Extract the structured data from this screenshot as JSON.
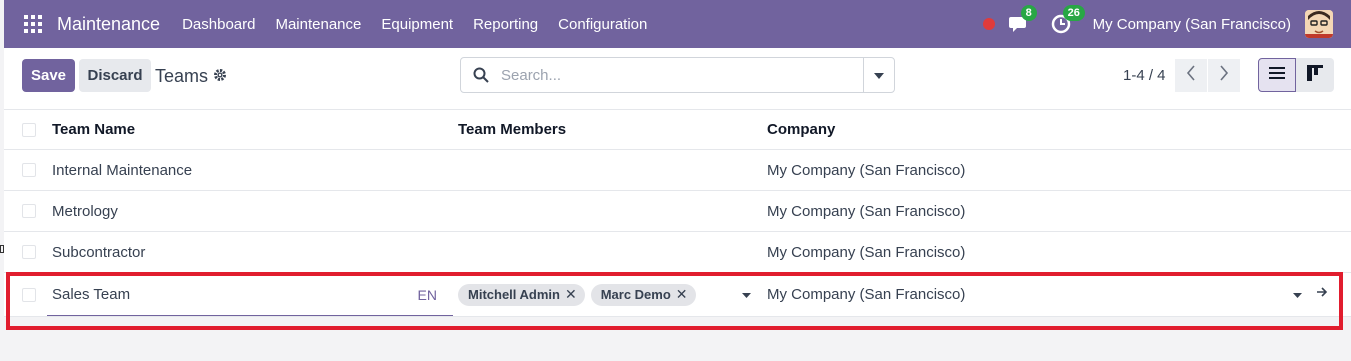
{
  "navbar": {
    "brand": "Maintenance",
    "menu": [
      "Dashboard",
      "Maintenance",
      "Equipment",
      "Reporting",
      "Configuration"
    ],
    "messages_count": "8",
    "activities_count": "26",
    "company": "My Company (San Francisco)",
    "accent_color": "#71639e"
  },
  "control": {
    "save_label": "Save",
    "discard_label": "Discard",
    "breadcrumb": "Teams",
    "search_placeholder": "Search...",
    "pager": "1-4 / 4"
  },
  "list": {
    "columns": {
      "name": "Team Name",
      "members": "Team Members",
      "company": "Company"
    },
    "rows": [
      {
        "name": "Internal Maintenance",
        "company": "My Company (San Francisco)"
      },
      {
        "name": "Metrology",
        "company": "My Company (San Francisco)"
      },
      {
        "name": "Subcontractor",
        "company": "My Company (San Francisco)"
      }
    ],
    "editing": {
      "name": "Sales Team",
      "lang": "EN",
      "members": [
        "Mitchell Admin",
        "Marc Demo"
      ],
      "company": "My Company (San Francisco)"
    }
  },
  "icons": [
    "apps-grid-icon",
    "chat-icon",
    "clock-icon",
    "gear-icon",
    "search-icon",
    "caret-down-icon",
    "chevron-left-icon",
    "chevron-right-icon",
    "list-view-icon",
    "kanban-view-icon",
    "close-icon",
    "arrow-right-icon"
  ],
  "highlight_color": "#e11d2e"
}
